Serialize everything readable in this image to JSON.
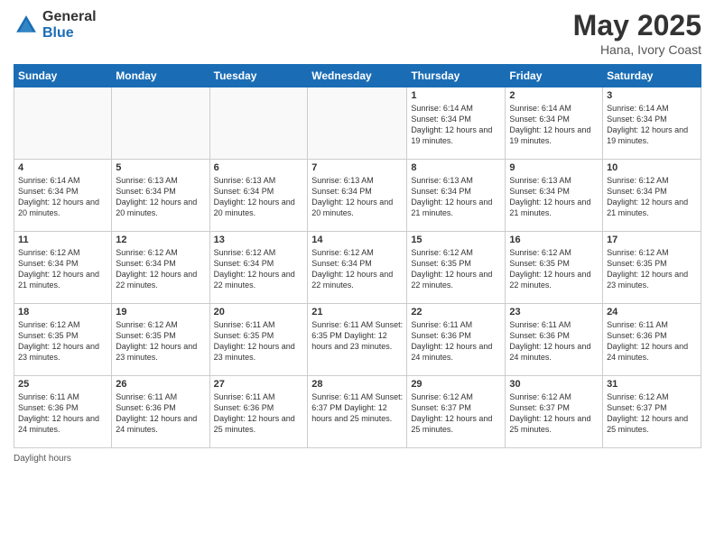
{
  "logo": {
    "general": "General",
    "blue": "Blue"
  },
  "title": {
    "month": "May 2025",
    "location": "Hana, Ivory Coast"
  },
  "days_of_week": [
    "Sunday",
    "Monday",
    "Tuesday",
    "Wednesday",
    "Thursday",
    "Friday",
    "Saturday"
  ],
  "footer": "Daylight hours",
  "weeks": [
    [
      {
        "day": "",
        "info": ""
      },
      {
        "day": "",
        "info": ""
      },
      {
        "day": "",
        "info": ""
      },
      {
        "day": "",
        "info": ""
      },
      {
        "day": "1",
        "info": "Sunrise: 6:14 AM\nSunset: 6:34 PM\nDaylight: 12 hours\nand 19 minutes."
      },
      {
        "day": "2",
        "info": "Sunrise: 6:14 AM\nSunset: 6:34 PM\nDaylight: 12 hours\nand 19 minutes."
      },
      {
        "day": "3",
        "info": "Sunrise: 6:14 AM\nSunset: 6:34 PM\nDaylight: 12 hours\nand 19 minutes."
      }
    ],
    [
      {
        "day": "4",
        "info": "Sunrise: 6:14 AM\nSunset: 6:34 PM\nDaylight: 12 hours\nand 20 minutes."
      },
      {
        "day": "5",
        "info": "Sunrise: 6:13 AM\nSunset: 6:34 PM\nDaylight: 12 hours\nand 20 minutes."
      },
      {
        "day": "6",
        "info": "Sunrise: 6:13 AM\nSunset: 6:34 PM\nDaylight: 12 hours\nand 20 minutes."
      },
      {
        "day": "7",
        "info": "Sunrise: 6:13 AM\nSunset: 6:34 PM\nDaylight: 12 hours\nand 20 minutes."
      },
      {
        "day": "8",
        "info": "Sunrise: 6:13 AM\nSunset: 6:34 PM\nDaylight: 12 hours\nand 21 minutes."
      },
      {
        "day": "9",
        "info": "Sunrise: 6:13 AM\nSunset: 6:34 PM\nDaylight: 12 hours\nand 21 minutes."
      },
      {
        "day": "10",
        "info": "Sunrise: 6:12 AM\nSunset: 6:34 PM\nDaylight: 12 hours\nand 21 minutes."
      }
    ],
    [
      {
        "day": "11",
        "info": "Sunrise: 6:12 AM\nSunset: 6:34 PM\nDaylight: 12 hours\nand 21 minutes."
      },
      {
        "day": "12",
        "info": "Sunrise: 6:12 AM\nSunset: 6:34 PM\nDaylight: 12 hours\nand 22 minutes."
      },
      {
        "day": "13",
        "info": "Sunrise: 6:12 AM\nSunset: 6:34 PM\nDaylight: 12 hours\nand 22 minutes."
      },
      {
        "day": "14",
        "info": "Sunrise: 6:12 AM\nSunset: 6:34 PM\nDaylight: 12 hours\nand 22 minutes."
      },
      {
        "day": "15",
        "info": "Sunrise: 6:12 AM\nSunset: 6:35 PM\nDaylight: 12 hours\nand 22 minutes."
      },
      {
        "day": "16",
        "info": "Sunrise: 6:12 AM\nSunset: 6:35 PM\nDaylight: 12 hours\nand 22 minutes."
      },
      {
        "day": "17",
        "info": "Sunrise: 6:12 AM\nSunset: 6:35 PM\nDaylight: 12 hours\nand 23 minutes."
      }
    ],
    [
      {
        "day": "18",
        "info": "Sunrise: 6:12 AM\nSunset: 6:35 PM\nDaylight: 12 hours\nand 23 minutes."
      },
      {
        "day": "19",
        "info": "Sunrise: 6:12 AM\nSunset: 6:35 PM\nDaylight: 12 hours\nand 23 minutes."
      },
      {
        "day": "20",
        "info": "Sunrise: 6:11 AM\nSunset: 6:35 PM\nDaylight: 12 hours\nand 23 minutes."
      },
      {
        "day": "21",
        "info": "Sunrise: 6:11 AM\nSunset: 6:35 PM\nDaylight: 12 hours\nand 23 minutes."
      },
      {
        "day": "22",
        "info": "Sunrise: 6:11 AM\nSunset: 6:36 PM\nDaylight: 12 hours\nand 24 minutes."
      },
      {
        "day": "23",
        "info": "Sunrise: 6:11 AM\nSunset: 6:36 PM\nDaylight: 12 hours\nand 24 minutes."
      },
      {
        "day": "24",
        "info": "Sunrise: 6:11 AM\nSunset: 6:36 PM\nDaylight: 12 hours\nand 24 minutes."
      }
    ],
    [
      {
        "day": "25",
        "info": "Sunrise: 6:11 AM\nSunset: 6:36 PM\nDaylight: 12 hours\nand 24 minutes."
      },
      {
        "day": "26",
        "info": "Sunrise: 6:11 AM\nSunset: 6:36 PM\nDaylight: 12 hours\nand 24 minutes."
      },
      {
        "day": "27",
        "info": "Sunrise: 6:11 AM\nSunset: 6:36 PM\nDaylight: 12 hours\nand 25 minutes."
      },
      {
        "day": "28",
        "info": "Sunrise: 6:11 AM\nSunset: 6:37 PM\nDaylight: 12 hours\nand 25 minutes."
      },
      {
        "day": "29",
        "info": "Sunrise: 6:12 AM\nSunset: 6:37 PM\nDaylight: 12 hours\nand 25 minutes."
      },
      {
        "day": "30",
        "info": "Sunrise: 6:12 AM\nSunset: 6:37 PM\nDaylight: 12 hours\nand 25 minutes."
      },
      {
        "day": "31",
        "info": "Sunrise: 6:12 AM\nSunset: 6:37 PM\nDaylight: 12 hours\nand 25 minutes."
      }
    ]
  ]
}
